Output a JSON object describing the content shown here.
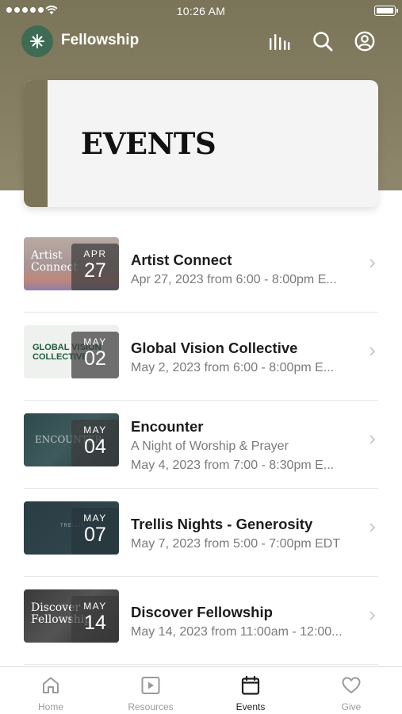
{
  "status_bar": {
    "time": "10:26 AM"
  },
  "app_bar": {
    "title": "Fellowship"
  },
  "hero": {
    "title": "EVENTS"
  },
  "events": [
    {
      "title": "Artist Connect",
      "lines": [
        "Apr 27, 2023 from 6:00 - 8:00pm E..."
      ],
      "month": "APR",
      "day": "27",
      "thumb_text": "Artist Connect"
    },
    {
      "title": "Global Vision Collective",
      "lines": [
        "May 2, 2023 from 6:00 - 8:00pm E..."
      ],
      "month": "MAY",
      "day": "02",
      "thumb_text": "GLOBAL VISION COLLECTIVE"
    },
    {
      "title": "Encounter",
      "lines": [
        "A Night of Worship & Prayer",
        "May 4, 2023 from 7:00 - 8:30pm E..."
      ],
      "month": "MAY",
      "day": "04",
      "thumb_text": "ENCOUNTER"
    },
    {
      "title": "Trellis Nights - Generosity",
      "lines": [
        "May 7, 2023 from 5:00 - 7:00pm EDT"
      ],
      "month": "MAY",
      "day": "07",
      "thumb_text": "TRELLIS"
    },
    {
      "title": "Discover Fellowship",
      "lines": [
        "May 14, 2023 from 11:00am - 12:00..."
      ],
      "month": "MAY",
      "day": "14",
      "thumb_text": "Discover Fellowship"
    }
  ],
  "nav": {
    "items": [
      {
        "label": "Home",
        "icon": "home-icon"
      },
      {
        "label": "Resources",
        "icon": "play-icon"
      },
      {
        "label": "Events",
        "icon": "calendar-icon"
      },
      {
        "label": "Give",
        "icon": "heart-icon"
      }
    ],
    "active": "Events"
  },
  "colors": {
    "header": "#7a7458",
    "logo_bg": "#3f6b55",
    "stripe": "#7d7559"
  }
}
